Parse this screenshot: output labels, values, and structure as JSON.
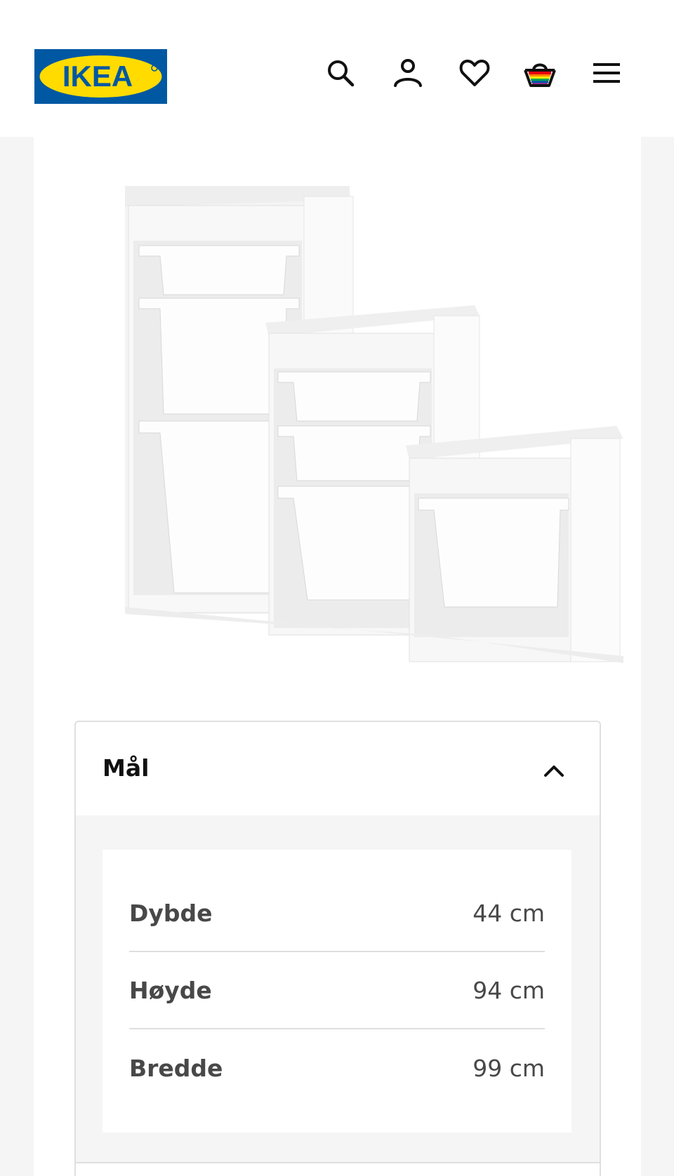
{
  "header": {
    "logo_text": "IKEA",
    "icons": [
      "search-icon",
      "user-icon",
      "heart-icon",
      "basket-icon",
      "menu-icon"
    ],
    "brand_blue": "#0058a3",
    "brand_yellow": "#ffdb00"
  },
  "product": {
    "image": "white-storage-unit-with-bins"
  },
  "dimensions": {
    "title": "Mål",
    "rows": [
      {
        "label": "Dybde",
        "value": "44 cm"
      },
      {
        "label": "Høyde",
        "value": "94 cm"
      },
      {
        "label": "Bredde",
        "value": "99 cm"
      }
    ]
  }
}
